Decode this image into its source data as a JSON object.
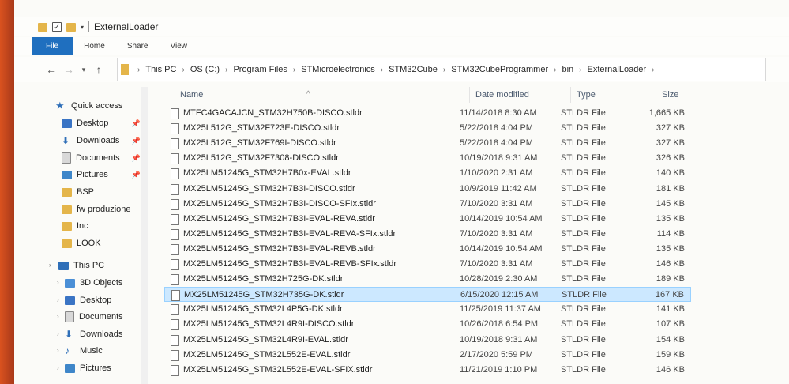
{
  "window": {
    "title": "ExternalLoader"
  },
  "ribbon": {
    "tabs": [
      "File",
      "Home",
      "Share",
      "View"
    ]
  },
  "address": {
    "crumbs": [
      "This PC",
      "OS (C:)",
      "Program Files",
      "STMicroelectronics",
      "STM32Cube",
      "STM32CubeProgrammer",
      "bin",
      "ExternalLoader"
    ]
  },
  "nav": {
    "quick_access": "Quick access",
    "items": [
      {
        "label": "Desktop",
        "icon": "desktop-icon",
        "pinned": true
      },
      {
        "label": "Downloads",
        "icon": "download-icon",
        "pinned": true
      },
      {
        "label": "Documents",
        "icon": "documents-icon",
        "pinned": true
      },
      {
        "label": "Pictures",
        "icon": "pictures-icon",
        "pinned": true
      },
      {
        "label": "BSP",
        "icon": "folder-icon",
        "pinned": false
      },
      {
        "label": "fw produzione",
        "icon": "folder-icon",
        "pinned": false
      },
      {
        "label": "Inc",
        "icon": "folder-icon",
        "pinned": false
      },
      {
        "label": "LOOK",
        "icon": "folder-icon",
        "pinned": false
      }
    ],
    "this_pc": "This PC",
    "pc_items": [
      {
        "label": "3D Objects",
        "icon": "objects-3d-icon"
      },
      {
        "label": "Desktop",
        "icon": "desktop-icon"
      },
      {
        "label": "Documents",
        "icon": "documents-icon"
      },
      {
        "label": "Downloads",
        "icon": "download-icon"
      },
      {
        "label": "Music",
        "icon": "music-icon"
      },
      {
        "label": "Pictures",
        "icon": "pictures-icon"
      }
    ]
  },
  "columns": {
    "name": "Name",
    "date": "Date modified",
    "type": "Type",
    "size": "Size"
  },
  "files": [
    {
      "name": "MTFC4GACAJCN_STM32H750B-DISCO.stldr",
      "date": "11/14/2018 8:30 AM",
      "type": "STLDR File",
      "size": "1,665 KB"
    },
    {
      "name": "MX25L512G_STM32F723E-DISCO.stldr",
      "date": "5/22/2018 4:04 PM",
      "type": "STLDR File",
      "size": "327 KB"
    },
    {
      "name": "MX25L512G_STM32F769I-DISCO.stldr",
      "date": "5/22/2018 4:04 PM",
      "type": "STLDR File",
      "size": "327 KB"
    },
    {
      "name": "MX25L512G_STM32F7308-DISCO.stldr",
      "date": "10/19/2018 9:31 AM",
      "type": "STLDR File",
      "size": "326 KB"
    },
    {
      "name": "MX25LM51245G_STM32H7B0x-EVAL.stldr",
      "date": "1/10/2020 2:31 AM",
      "type": "STLDR File",
      "size": "140 KB"
    },
    {
      "name": "MX25LM51245G_STM32H7B3I-DISCO.stldr",
      "date": "10/9/2019 11:42 AM",
      "type": "STLDR File",
      "size": "181 KB"
    },
    {
      "name": "MX25LM51245G_STM32H7B3I-DISCO-SFIx.stldr",
      "date": "7/10/2020 3:31 AM",
      "type": "STLDR File",
      "size": "145 KB"
    },
    {
      "name": "MX25LM51245G_STM32H7B3I-EVAL-REVA.stldr",
      "date": "10/14/2019 10:54 AM",
      "type": "STLDR File",
      "size": "135 KB"
    },
    {
      "name": "MX25LM51245G_STM32H7B3I-EVAL-REVA-SFIx.stldr",
      "date": "7/10/2020 3:31 AM",
      "type": "STLDR File",
      "size": "114 KB"
    },
    {
      "name": "MX25LM51245G_STM32H7B3I-EVAL-REVB.stldr",
      "date": "10/14/2019 10:54 AM",
      "type": "STLDR File",
      "size": "135 KB"
    },
    {
      "name": "MX25LM51245G_STM32H7B3I-EVAL-REVB-SFIx.stldr",
      "date": "7/10/2020 3:31 AM",
      "type": "STLDR File",
      "size": "146 KB"
    },
    {
      "name": "MX25LM51245G_STM32H725G-DK.stldr",
      "date": "10/28/2019 2:30 AM",
      "type": "STLDR File",
      "size": "189 KB"
    },
    {
      "name": "MX25LM51245G_STM32H735G-DK.stldr",
      "date": "6/15/2020 12:15 AM",
      "type": "STLDR File",
      "size": "167 KB",
      "selected": true
    },
    {
      "name": "MX25LM51245G_STM32L4P5G-DK.stldr",
      "date": "11/25/2019 11:37 AM",
      "type": "STLDR File",
      "size": "141 KB"
    },
    {
      "name": "MX25LM51245G_STM32L4R9I-DISCO.stldr",
      "date": "10/26/2018 6:54 PM",
      "type": "STLDR File",
      "size": "107 KB"
    },
    {
      "name": "MX25LM51245G_STM32L4R9I-EVAL.stldr",
      "date": "10/19/2018 9:31 AM",
      "type": "STLDR File",
      "size": "154 KB"
    },
    {
      "name": "MX25LM51245G_STM32L552E-EVAL.stldr",
      "date": "2/17/2020 5:59 PM",
      "type": "STLDR File",
      "size": "159 KB"
    },
    {
      "name": "MX25LM51245G_STM32L552E-EVAL-SFIX.stldr",
      "date": "11/21/2019 1:10 PM",
      "type": "STLDR File",
      "size": "146 KB"
    }
  ]
}
